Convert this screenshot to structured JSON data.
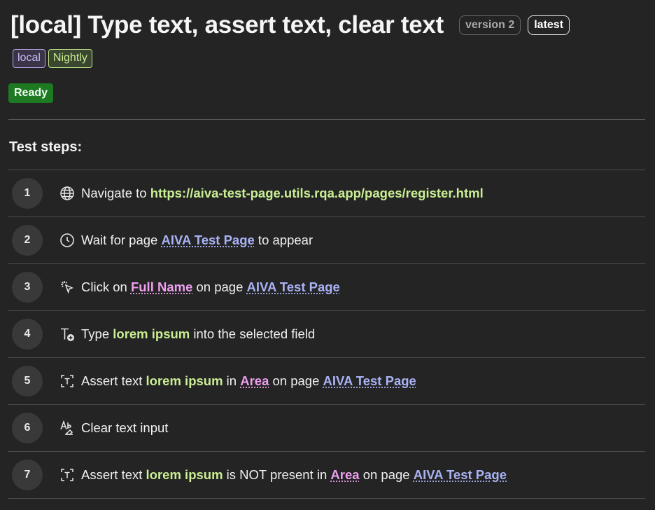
{
  "header": {
    "title": "[local] Type text, assert text, clear text",
    "version_badge": "version 2",
    "latest_badge": "latest"
  },
  "tags": [
    "local",
    "Nightly"
  ],
  "status": "Ready",
  "section_title": "Test steps:",
  "steps": [
    {
      "number": "1",
      "icon": "globe-icon",
      "parts": [
        "Navigate to ",
        "https://aiva-test-page.utils.rqa.app/pages/register.html"
      ]
    },
    {
      "number": "2",
      "icon": "clock-icon",
      "parts": [
        "Wait for page ",
        "AIVA Test Page",
        " to appear"
      ]
    },
    {
      "number": "3",
      "icon": "cursor-click-icon",
      "parts": [
        "Click on ",
        "Full Name",
        " on page ",
        "AIVA Test Page"
      ]
    },
    {
      "number": "4",
      "icon": "text-add-icon",
      "parts": [
        "Type ",
        "lorem ipsum",
        " into the selected field"
      ]
    },
    {
      "number": "5",
      "icon": "text-frame-icon",
      "parts": [
        "Assert text ",
        "lorem ipsum",
        " in ",
        "Area",
        " on page ",
        "AIVA Test Page"
      ]
    },
    {
      "number": "6",
      "icon": "text-clear-icon",
      "parts": [
        "Clear text input"
      ]
    },
    {
      "number": "7",
      "icon": "text-frame-icon",
      "parts": [
        "Assert text ",
        "lorem ipsum",
        " is NOT present in ",
        "Area",
        " on page ",
        "AIVA Test Page"
      ]
    }
  ],
  "colors": {
    "background": "#242424",
    "value": "#c9ee93",
    "page_link": "#a9b2f5",
    "element_link": "#ee9ff0",
    "status_ready": "#1d7a23"
  }
}
